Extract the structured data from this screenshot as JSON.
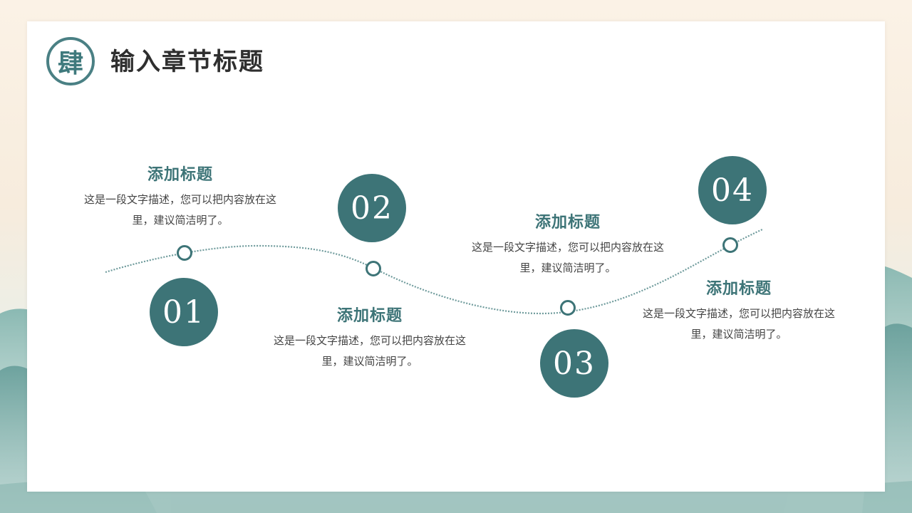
{
  "chapter": {
    "seal_char": "肆",
    "title": "输入章节标题"
  },
  "steps": [
    {
      "number": "01",
      "title": "添加标题",
      "desc_line1": "这是一段文字描述，您可以把内容放在这",
      "desc_line2": "里，建议简洁明了。"
    },
    {
      "number": "02",
      "title": "添加标题",
      "desc_line1": "这是一段文字描述，您可以把内容放在这",
      "desc_line2": "里，建议简洁明了。"
    },
    {
      "number": "03",
      "title": "添加标题",
      "desc_line1": "这是一段文字描述，您可以把内容放在这",
      "desc_line2": "里，建议简洁明了。"
    },
    {
      "number": "04",
      "title": "添加标题",
      "desc_line1": "这是一段文字描述，您可以把内容放在这",
      "desc_line2": "里，建议简洁明了。"
    }
  ],
  "colors": {
    "accent": "#3d7477",
    "title_text": "#2f2f2f",
    "body_text": "#444444"
  }
}
